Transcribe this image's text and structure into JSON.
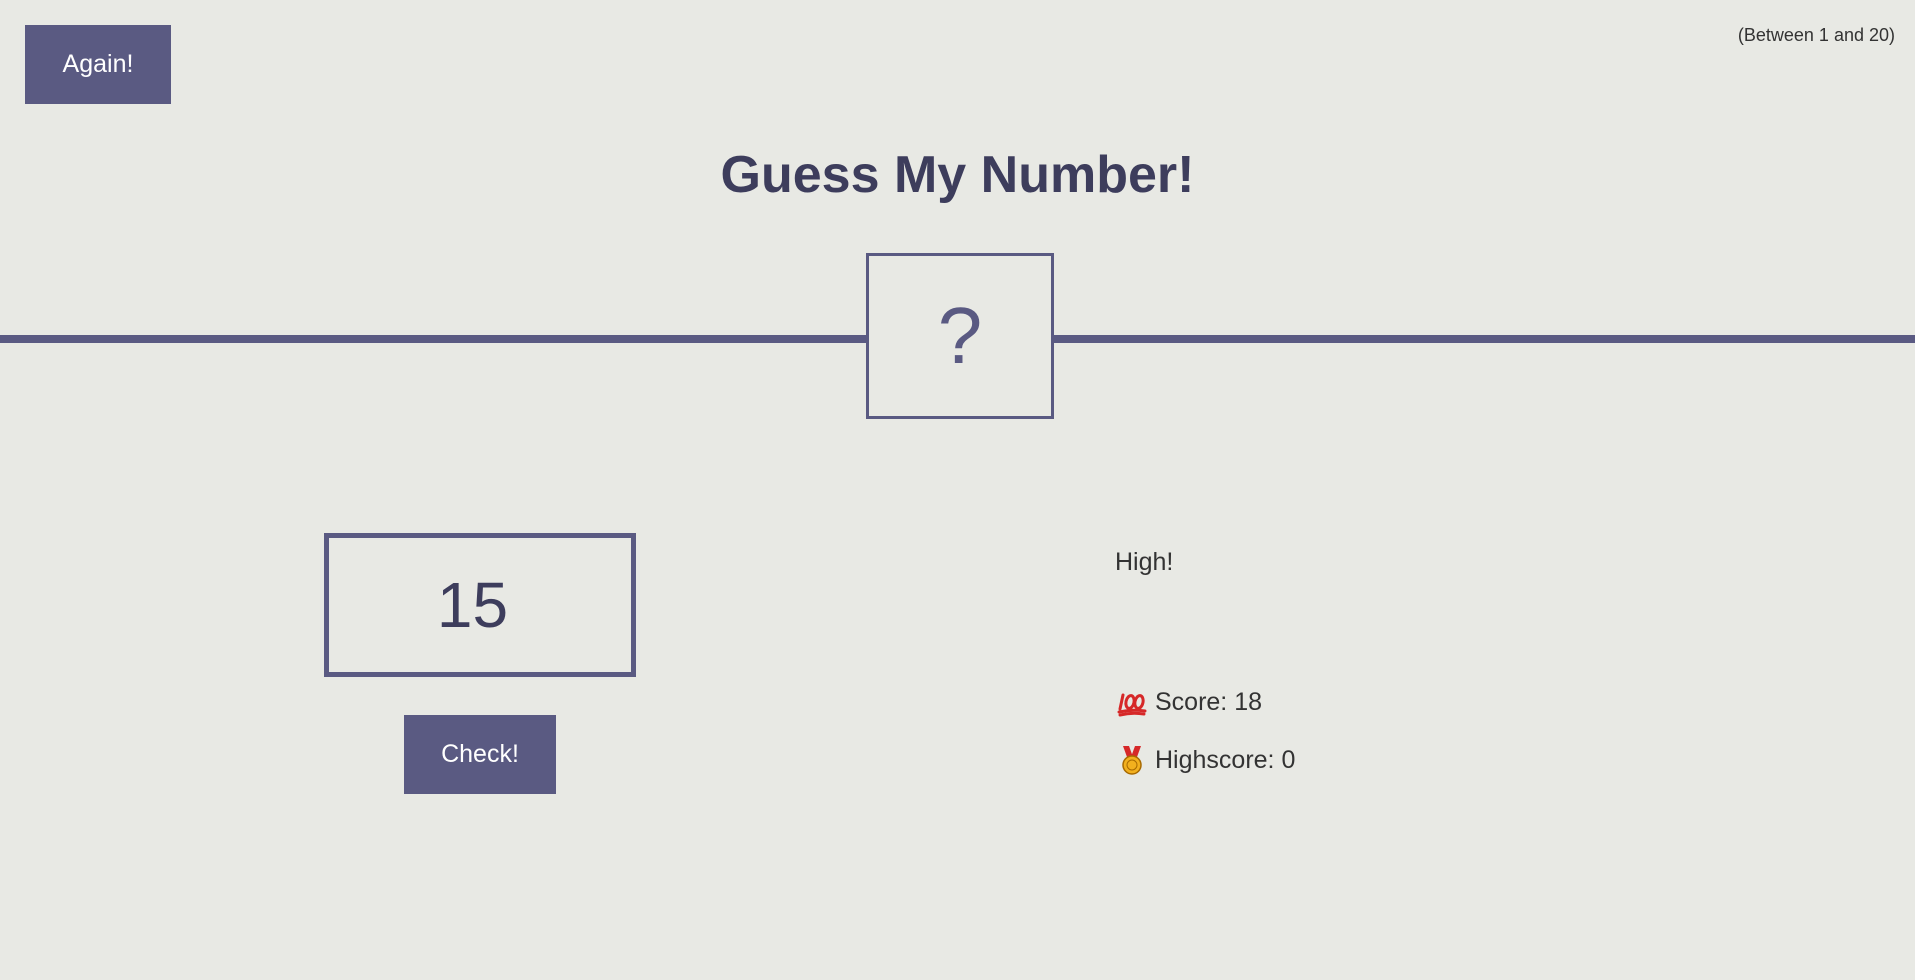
{
  "header": {
    "again_label": "Again!",
    "range_hint": "(Between 1 and 20)"
  },
  "title": "Guess My Number!",
  "secret": {
    "display": "?"
  },
  "guess": {
    "value": "15"
  },
  "check_label": "Check!",
  "message": "High!",
  "stats": {
    "score_label": "Score:",
    "score_value": "18",
    "highscore_label": "Highscore:",
    "highscore_value": "0",
    "score_icon": "hundred-points-icon",
    "highscore_icon": "medal-icon"
  },
  "colors": {
    "background": "#e8e9e4",
    "accent": "#5a5a82",
    "title": "#3d3d5c"
  }
}
